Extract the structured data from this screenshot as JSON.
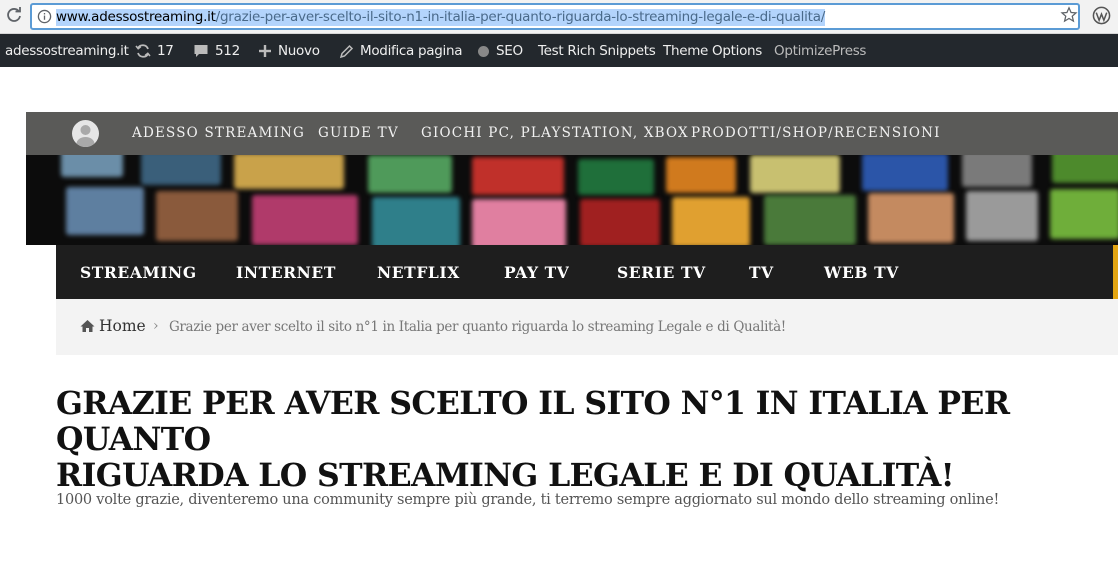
{
  "browser": {
    "url_domain": "www.adessostreaming.it",
    "url_path": "/grazie-per-aver-scelto-il-sito-n1-in-italia-per-quanto-riguarda-lo-streaming-legale-e-di-qualita/",
    "icons": [
      "reload-icon",
      "info-icon",
      "star-icon",
      "wordpress-extension-icon"
    ]
  },
  "adminbar": {
    "site_name": "adessostreaming.it",
    "updates_count": "17",
    "comments_count": "512",
    "new_label": "Nuovo",
    "edit_label": "Modifica pagina",
    "seo_label": "SEO",
    "rich_snippets_label": "Test Rich Snippets",
    "theme_options_label": "Theme Options",
    "optimizepress_label": "OptimizePress"
  },
  "topnav": {
    "items": [
      "ADESSO STREAMING",
      "GUIDE TV",
      "GIOCHI PC, PLAYSTATION, XBOX",
      "PRODOTTI/SHOP/RECENSIONI"
    ]
  },
  "mainnav": {
    "items": [
      "STREAMING",
      "INTERNET",
      "NETFLIX",
      "PAY TV",
      "SERIE TV",
      "TV",
      "WEB TV"
    ],
    "accent_color": "#e3a512"
  },
  "breadcrumb": {
    "home": "Home",
    "separator": "›",
    "current": "Grazie per aver scelto il sito n°1 in Italia per quanto riguarda lo streaming Legale e di Qualità!"
  },
  "page": {
    "title": "Grazie per aver scelto il sito n°1 in Italia per quanto\nriguarda lo streaming Legale e di Qualità!",
    "text": "1000 volte grazie, diventeremo una community sempre più grande, ti terremo sempre aggiornato sul mondo dello streaming online!"
  }
}
